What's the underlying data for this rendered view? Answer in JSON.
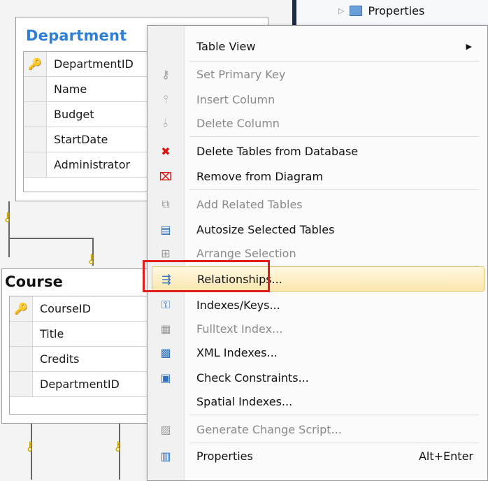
{
  "object_explorer": {
    "properties_label": "Properties"
  },
  "department": {
    "title": "Department",
    "columns": [
      "DepartmentID",
      "Name",
      "Budget",
      "StartDate",
      "Administrator"
    ]
  },
  "course": {
    "title": "Course",
    "columns": [
      "CourseID",
      "Title",
      "Credits",
      "DepartmentID"
    ]
  },
  "context_menu": {
    "table_view": "Table View",
    "set_primary_key": "Set Primary Key",
    "insert_column": "Insert Column",
    "delete_column": "Delete Column",
    "delete_tables": "Delete Tables from Database",
    "remove_from_diagram": "Remove from Diagram",
    "add_related_tables": "Add Related Tables",
    "autosize_tables": "Autosize Selected Tables",
    "arrange_selection": "Arrange Selection",
    "relationships": "Relationships...",
    "indexes_keys": "Indexes/Keys...",
    "fulltext_index": "Fulltext Index...",
    "xml_indexes": "XML Indexes...",
    "check_constraints": "Check Constraints...",
    "spatial_indexes": "Spatial Indexes...",
    "generate_change_script": "Generate Change Script...",
    "properties": "Properties",
    "properties_shortcut": "Alt+Enter"
  },
  "colors": {
    "highlight_border": "#e21b1b",
    "department_title": "#2f7fd4"
  }
}
